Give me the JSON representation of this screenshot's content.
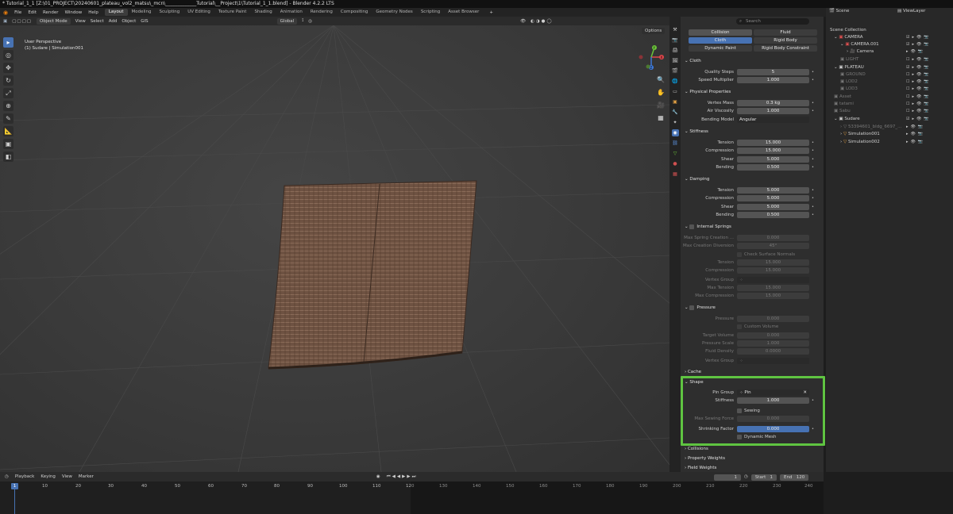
{
  "window": {
    "title": "* Tutorial_1_1 [Z:\\01_PROJECT\\20240601_plateau_vol2_matsu\\_mcn\\_____________Tutorial\\__Project\\1\\Tutorial_1_1.blend] - Blender 4.2.2 LTS"
  },
  "menu": {
    "items": [
      "File",
      "Edit",
      "Render",
      "Window",
      "Help"
    ],
    "workspaces": [
      "Layout",
      "Modeling",
      "Sculpting",
      "UV Editing",
      "Texture Paint",
      "Shading",
      "Animation",
      "Rendering",
      "Compositing",
      "Geometry Nodes",
      "Scripting",
      "Asset Browser"
    ],
    "active_workspace": "Layout"
  },
  "header": {
    "mode": "Object Mode",
    "items": [
      "View",
      "Select",
      "Add",
      "Object"
    ],
    "gis": "GIS",
    "orientation": "Global"
  },
  "viewport": {
    "line1": "User Perspective",
    "line2": "(1) Sudare | Simulation001",
    "options": "Options",
    "gizmo": {
      "x": "X",
      "y": "Y",
      "z": "Z"
    }
  },
  "properties": {
    "search_placeholder": "Search",
    "physics_buttons": [
      "Collision",
      "Fluid",
      "Cloth",
      "Rigid Body",
      "Dynamic Paint",
      "Rigid Body Constraint"
    ],
    "cloth": {
      "title": "Cloth",
      "quality_steps": {
        "label": "Quality Steps",
        "value": "5"
      },
      "speed_multiplier": {
        "label": "Speed Multiplier",
        "value": "1.000"
      }
    },
    "physical": {
      "title": "Physical Properties",
      "vertex_mass": {
        "label": "Vertex Mass",
        "value": "0.3 kg"
      },
      "air_viscosity": {
        "label": "Air Viscosity",
        "value": "1.000"
      },
      "bending_model": {
        "label": "Bending Model",
        "value": "Angular"
      }
    },
    "stiffness": {
      "title": "Stiffness",
      "tension": {
        "label": "Tension",
        "value": "15.000"
      },
      "compression": {
        "label": "Compression",
        "value": "15.000"
      },
      "shear": {
        "label": "Shear",
        "value": "5.000"
      },
      "bending": {
        "label": "Bending",
        "value": "0.500"
      }
    },
    "damping": {
      "title": "Damping",
      "tension": {
        "label": "Tension",
        "value": "5.000"
      },
      "compression": {
        "label": "Compression",
        "value": "5.000"
      },
      "shear": {
        "label": "Shear",
        "value": "5.000"
      },
      "bending": {
        "label": "Bending",
        "value": "0.500"
      }
    },
    "internal_springs": {
      "title": "Internal Springs",
      "max_creation": {
        "label": "Max Spring Creation ...",
        "value": "0.000"
      },
      "max_diversion": {
        "label": "Max Creation Diversion",
        "value": "45°"
      },
      "check_normals": "Check Surface Normals",
      "tension": {
        "label": "Tension",
        "value": "15.000"
      },
      "compression": {
        "label": "Compression",
        "value": "15.000"
      },
      "vertex_group": {
        "label": "Vertex Group"
      },
      "max_tension": {
        "label": "Max Tension",
        "value": "15.000"
      },
      "max_compression": {
        "label": "Max Compression",
        "value": "15.000"
      }
    },
    "pressure": {
      "title": "Pressure",
      "pressure": {
        "label": "Pressure",
        "value": "0.000"
      },
      "custom_volume": "Custom Volume",
      "target_volume": {
        "label": "Target Volume",
        "value": "0.000"
      },
      "pressure_scale": {
        "label": "Pressure Scale",
        "value": "1.000"
      },
      "fluid_density": {
        "label": "Fluid Density",
        "value": "0.0000"
      },
      "vertex_group": {
        "label": "Vertex Group"
      }
    },
    "cache": {
      "title": "Cache"
    },
    "shape": {
      "title": "Shape",
      "pin_group": {
        "label": "Pin Group",
        "value": "Pin"
      },
      "stiffness": {
        "label": "Stiffness",
        "value": "1.000"
      },
      "sewing": "Sewing",
      "max_sewing": {
        "label": "Max Sewing Force",
        "value": "0.000"
      },
      "shrinking": {
        "label": "Shrinking Factor",
        "value": "0.000"
      },
      "dynamic_mesh": "Dynamic Mesh"
    },
    "collapsed": [
      "Collisions",
      "Property Weights",
      "Field Weights"
    ]
  },
  "outliner": {
    "scene": "Scene",
    "view_layer": "ViewLayer",
    "rows": [
      {
        "name": "Scene Collection",
        "indent": 0
      },
      {
        "name": "CAMERA",
        "indent": 1
      },
      {
        "name": "CAMERA.001",
        "indent": 2
      },
      {
        "name": "Camera",
        "indent": 3
      },
      {
        "name": "LIGHT",
        "indent": 2
      },
      {
        "name": "PLATEAU",
        "indent": 1
      },
      {
        "name": "GROUND",
        "indent": 2
      },
      {
        "name": "LOD2",
        "indent": 2
      },
      {
        "name": "LOD3",
        "indent": 2
      },
      {
        "name": "Asset",
        "indent": 1
      },
      {
        "name": "tatami",
        "indent": 1
      },
      {
        "name": "Sabu",
        "indent": 1
      },
      {
        "name": "Sudare",
        "indent": 1
      },
      {
        "name": "53394601_bldg_6697_...",
        "indent": 2
      },
      {
        "name": "Simulation001",
        "indent": 2
      },
      {
        "name": "Simulation002",
        "indent": 2
      }
    ]
  },
  "timeline": {
    "menu": [
      "Playback",
      "Keying",
      "View",
      "Marker"
    ],
    "current_frame": "1",
    "start_label": "Start",
    "start": "1",
    "end_label": "End",
    "end": "120",
    "ticks": [
      "1",
      "10",
      "20",
      "30",
      "40",
      "50",
      "60",
      "70",
      "80",
      "90",
      "100",
      "110",
      "120",
      "130",
      "140",
      "150",
      "160",
      "170",
      "180",
      "190",
      "200",
      "210",
      "220",
      "230",
      "240"
    ]
  },
  "colors": {
    "accent": "#4772b3",
    "highlight": "#5fc441",
    "cloth": "#6b4f3e"
  }
}
